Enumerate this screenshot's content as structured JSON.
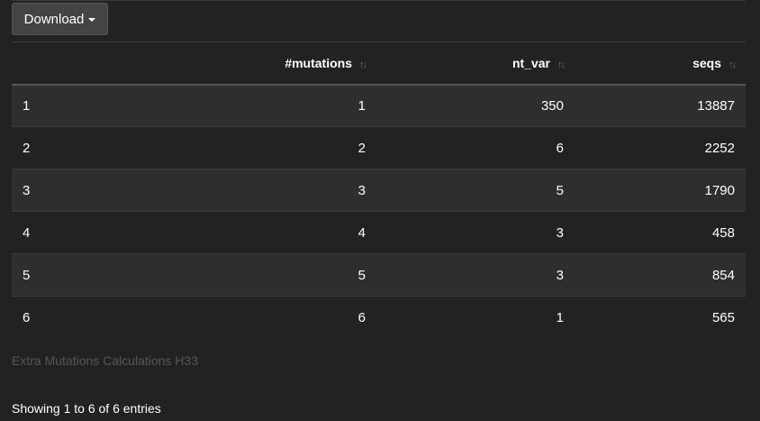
{
  "toolbar": {
    "download_label": "Download",
    "download_icon": "caret-down-icon"
  },
  "table": {
    "columns": [
      {
        "label": "",
        "sortable": false
      },
      {
        "label": "#mutations",
        "sortable": true
      },
      {
        "label": "nt_var",
        "sortable": true
      },
      {
        "label": "seqs",
        "sortable": true
      }
    ],
    "sort_icon": "sort-both-icon",
    "sort_glyph": "↑↓",
    "rows": [
      [
        "1",
        "1",
        "350",
        "13887"
      ],
      [
        "2",
        "2",
        "6",
        "2252"
      ],
      [
        "3",
        "3",
        "5",
        "1790"
      ],
      [
        "4",
        "4",
        "3",
        "458"
      ],
      [
        "5",
        "5",
        "3",
        "854"
      ],
      [
        "6",
        "6",
        "1",
        "565"
      ]
    ],
    "caption": "Extra Mutations Calculations H33"
  },
  "footer": {
    "info": "Showing 1 to 6 of 6 entries"
  },
  "colors": {
    "background": "#222222",
    "row_stripe": "#2e2e2e",
    "button_bg": "#444444",
    "caption": "#555555"
  }
}
